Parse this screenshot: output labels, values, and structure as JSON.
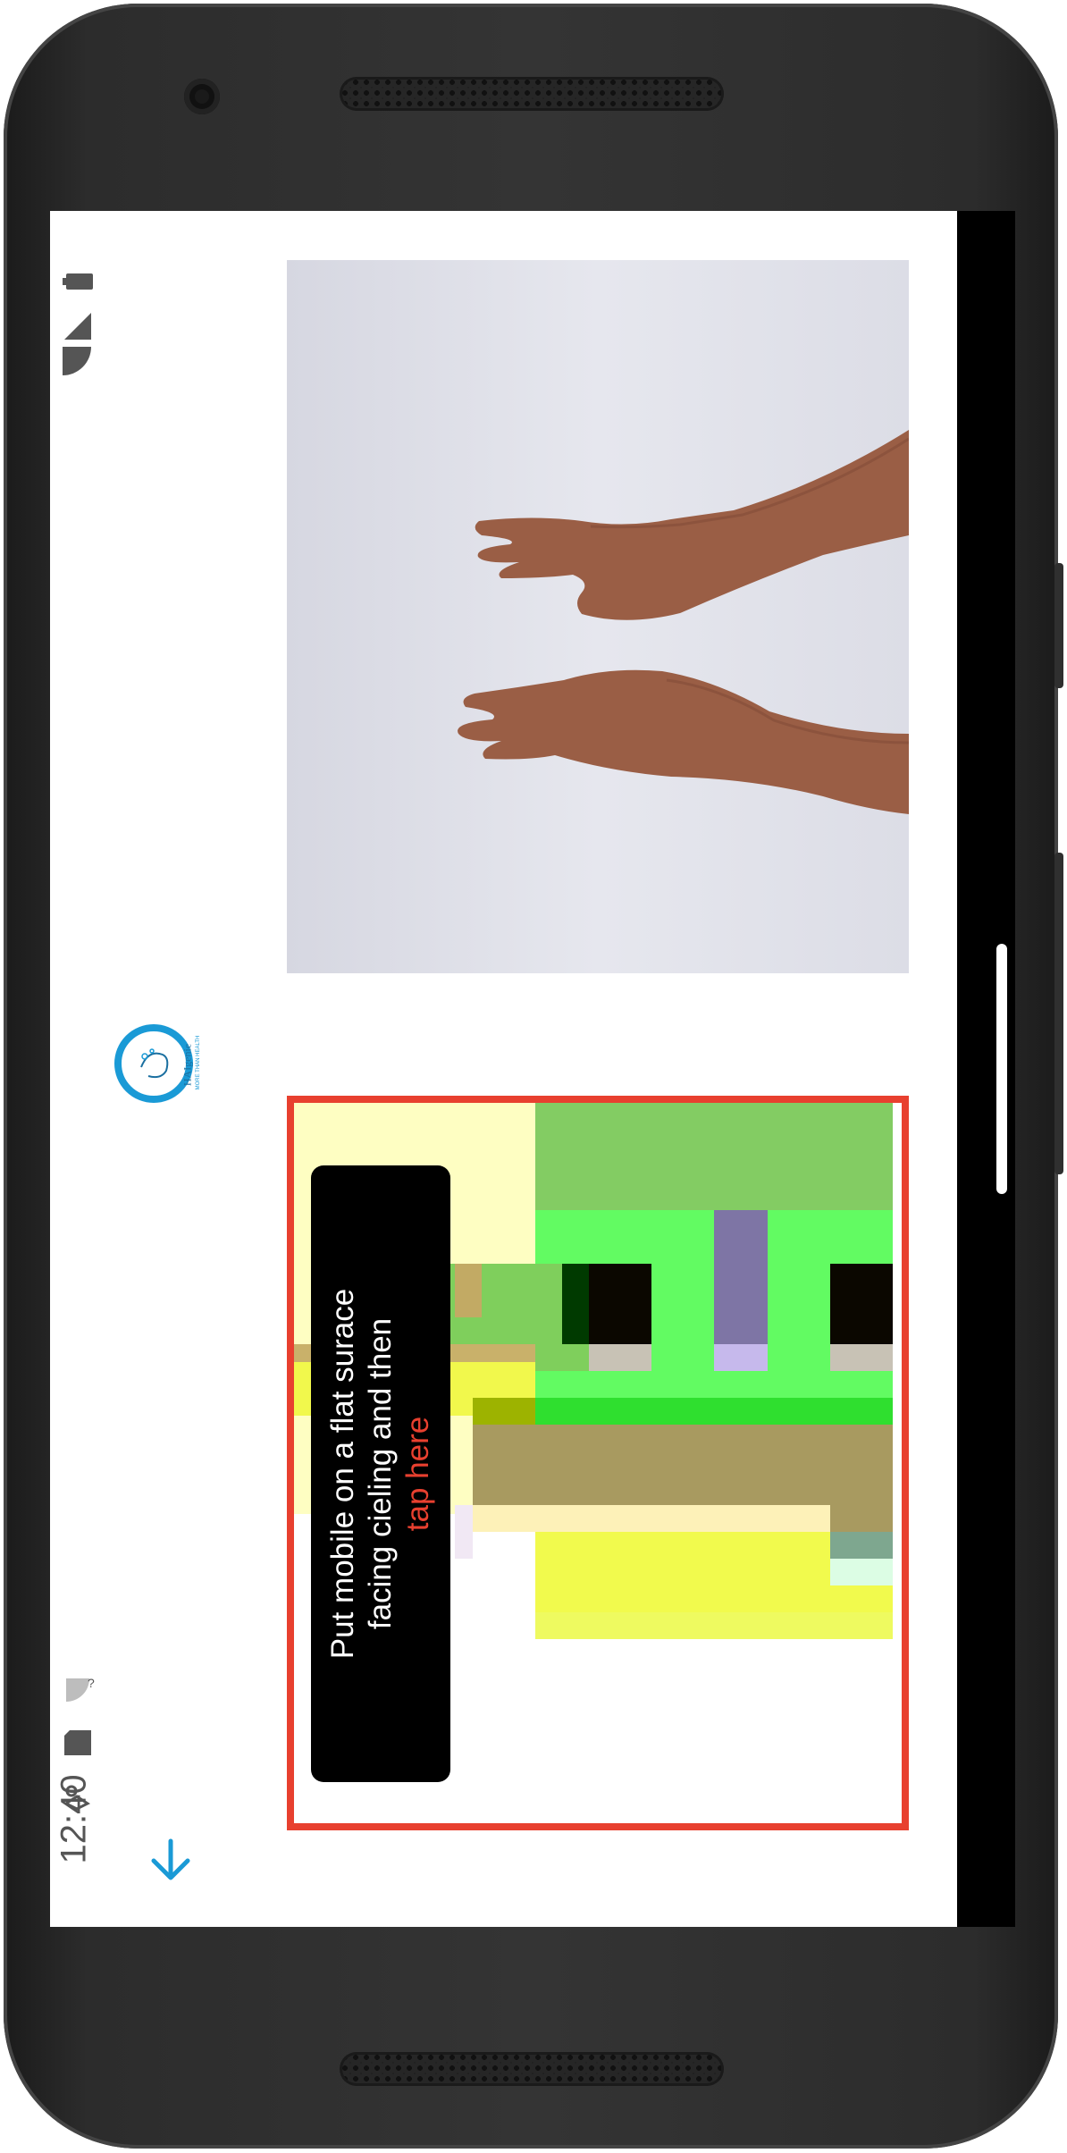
{
  "status_bar": {
    "time": "12:40"
  },
  "logo": {
    "name": "HAIgenie",
    "tagline": "MORE THAN HEALTH"
  },
  "instruction": {
    "line1": "Put mobile on a flat surace",
    "line2": "facing cieling and then",
    "action": "tap here"
  },
  "colors": {
    "accent": "#1a9ad6",
    "frame": "#e8402f"
  },
  "icons": {
    "battery": "battery-icon",
    "signal": "signal-icon",
    "wifi": "wifi-icon",
    "sd_card": "sd-card-icon",
    "download_arrow": "arrow-down-icon"
  }
}
